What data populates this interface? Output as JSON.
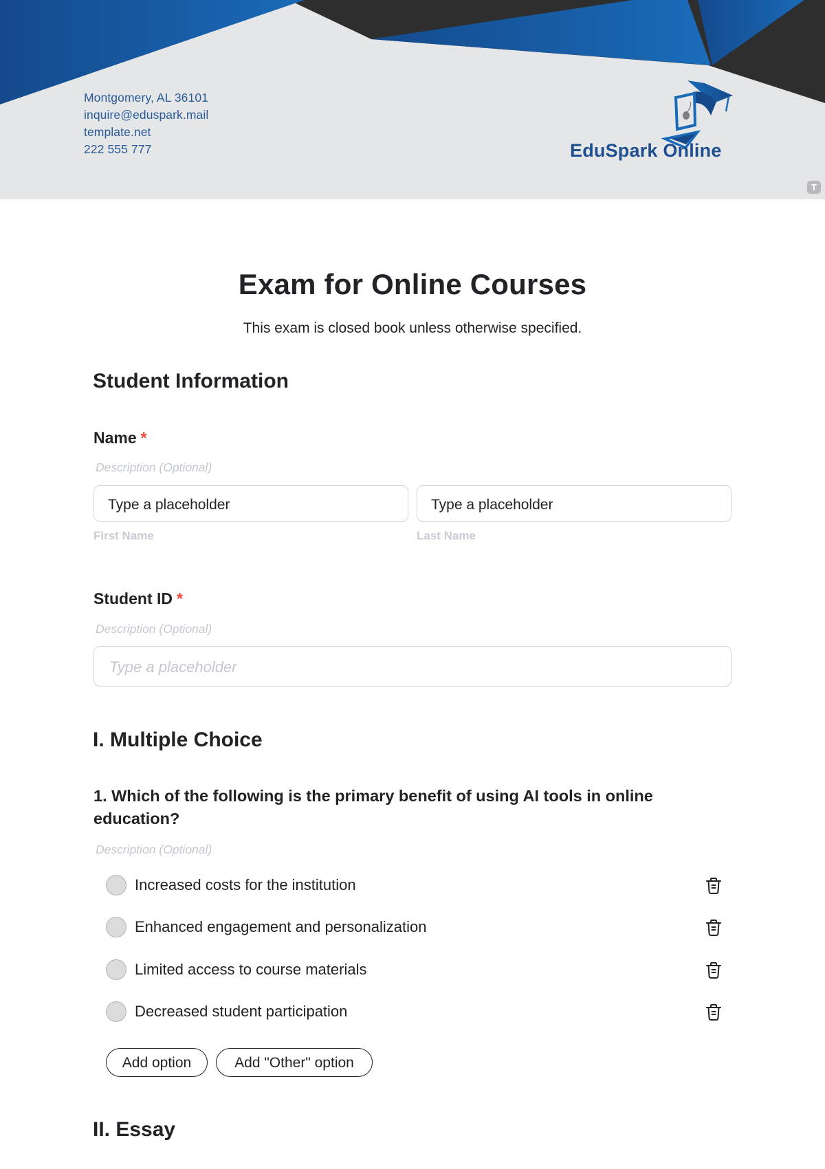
{
  "header": {
    "contact": {
      "address": "Montgomery, AL 36101",
      "email": "inquire@eduspark.mail",
      "website": "template.net",
      "phone": "222 555 777"
    },
    "brand_name": "EduSpark Online",
    "logo_icon": "laptop-graduation-cap-icon",
    "badge_letter": "T",
    "colors": {
      "blue": "#1a6ab8",
      "dark_blue": "#16498a",
      "charcoal": "#2e2e2f",
      "background": "#e5e6e8",
      "brand_text": "#1f4f8f"
    }
  },
  "form": {
    "title": "Exam for Online Courses",
    "subtitle": "This exam is closed book unless otherwise specified.",
    "sections": {
      "student_info": {
        "title": "Student Information",
        "name": {
          "label": "Name",
          "required_mark": "*",
          "description": "Description (Optional)",
          "first_value": "Type a placeholder",
          "first_sublabel": "First Name",
          "last_value": "Type a placeholder",
          "last_sublabel": "Last Name"
        },
        "student_id": {
          "label": "Student ID",
          "required_mark": "*",
          "description": "Description (Optional)",
          "placeholder": "Type a placeholder"
        }
      },
      "multiple_choice": {
        "title": "I. Multiple Choice",
        "question": "1. Which of the following is the primary benefit of using AI tools in online education?",
        "description": "Description (Optional)",
        "options": [
          {
            "label": "Increased costs for the institution",
            "selected": false
          },
          {
            "label": "Enhanced engagement and personalization",
            "selected": false
          },
          {
            "label": "Limited access to course materials",
            "selected": false
          },
          {
            "label": "Decreased student participation",
            "selected": false
          }
        ],
        "add_option_label": "Add option",
        "add_other_label": "Add \"Other\" option"
      },
      "essay": {
        "title": "II. Essay"
      }
    },
    "colors": {
      "required": "#ef4b3a",
      "text": "#222327",
      "muted": "#c3c8d0",
      "border": "#d2d6dc"
    }
  }
}
